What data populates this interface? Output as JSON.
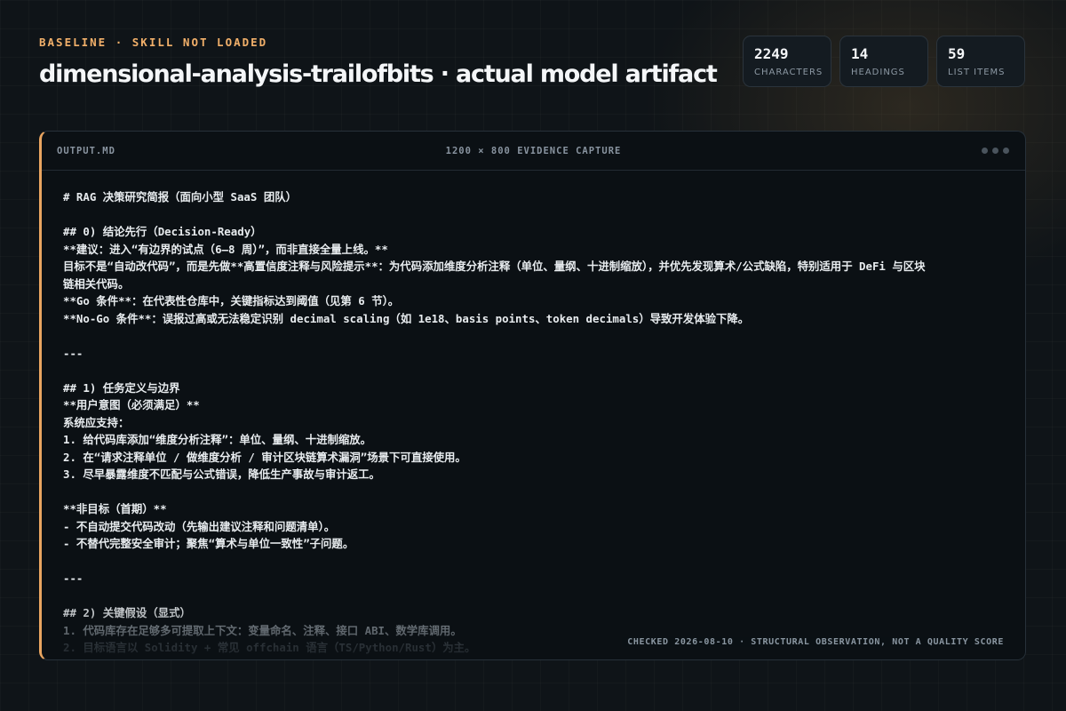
{
  "header": {
    "kicker": "BASELINE · SKILL NOT LOADED",
    "title": "dimensional-analysis-trailofbits · actual model artifact"
  },
  "stats": [
    {
      "value": "2249",
      "label": "CHARACTERS"
    },
    {
      "value": "14",
      "label": "HEADINGS"
    },
    {
      "value": "59",
      "label": "LIST ITEMS"
    }
  ],
  "panel": {
    "file_name": "OUTPUT.MD",
    "capture_label": "1200 × 800 EVIDENCE CAPTURE",
    "footer": "CHECKED 2026-08-10 · STRUCTURAL OBSERVATION, NOT A QUALITY SCORE",
    "lines": [
      "# RAG 决策研究简报（面向小型 SaaS 团队）",
      "",
      "## 0) 结论先行（Decision-Ready）",
      "**建议：进入“有边界的试点（6–8 周）”，而非直接全量上线。**",
      "目标不是“自动改代码”，而是先做**高置信度注释与风险提示**：为代码添加维度分析注释（单位、量纲、十进制缩放），并优先发现算术/公式缺陷，特别适用于 DeFi 与区块",
      "链相关代码。",
      "**Go 条件**：在代表性仓库中，关键指标达到阈值（见第 6 节）。",
      "**No-Go 条件**：误报过高或无法稳定识别 decimal scaling（如 1e18、basis points、token decimals）导致开发体验下降。",
      "",
      "---",
      "",
      "## 1) 任务定义与边界",
      "**用户意图（必须满足）**",
      "系统应支持：",
      "1. 给代码库添加“维度分析注释”：单位、量纲、十进制缩放。",
      "2. 在“请求注释单位 / 做维度分析 / 审计区块链算术漏洞”场景下可直接使用。",
      "3. 尽早暴露维度不匹配与公式错误，降低生产事故与审计返工。",
      "",
      "**非目标（首期）**",
      "- 不自动提交代码改动（先输出建议注释和问题清单）。",
      "- 不替代完整安全审计；聚焦“算术与单位一致性”子问题。",
      "",
      "---",
      "",
      "## 2) 关键假设（显式）",
      "1. 代码库存在足够多可提取上下文：变量命名、注释、接口 ABI、数学库调用。",
      "2. 目标语言以 Solidity + 常见 offchain 语言（TS/Python/Rust）为主。"
    ]
  }
}
